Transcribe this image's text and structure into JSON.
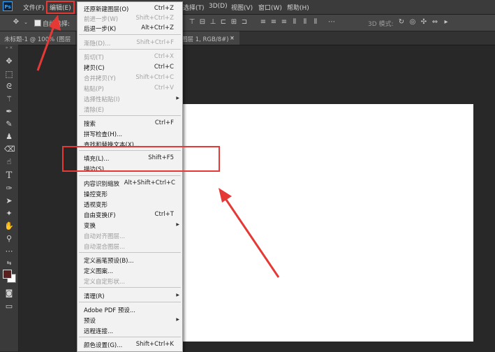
{
  "menubar": {
    "logo": "Ps",
    "items": [
      "文件(F)",
      "编辑(E)",
      "选择(T)",
      "3D(D)",
      "视图(V)",
      "窗口(W)",
      "帮助(H)"
    ]
  },
  "options_bar": {
    "auto_select_label": "自动选择:",
    "mode_label": "3D 模式:"
  },
  "tabs": [
    {
      "label": "未标题-1 @ 100% (图层"
    },
    {
      "label": "图层 1, RGB/8#) *"
    }
  ],
  "edit_menu": {
    "items": [
      {
        "label": "还原新建图层(O)",
        "shortcut": "Ctrl+Z",
        "enabled": true
      },
      {
        "label": "前进一步(W)",
        "shortcut": "Shift+Ctrl+Z",
        "enabled": false
      },
      {
        "label": "后退一步(K)",
        "shortcut": "Alt+Ctrl+Z",
        "enabled": true
      },
      {
        "label": "渐隐(D)...",
        "shortcut": "Shift+Ctrl+F",
        "enabled": false
      },
      {
        "label": "剪切(T)",
        "shortcut": "Ctrl+X",
        "enabled": false
      },
      {
        "label": "拷贝(C)",
        "shortcut": "Ctrl+C",
        "enabled": true
      },
      {
        "label": "合并拷贝(Y)",
        "shortcut": "Shift+Ctrl+C",
        "enabled": false
      },
      {
        "label": "粘贴(P)",
        "shortcut": "Ctrl+V",
        "enabled": false
      },
      {
        "label": "选择性粘贴(I)",
        "shortcut": "",
        "enabled": false,
        "submenu": true
      },
      {
        "label": "清除(E)",
        "shortcut": "",
        "enabled": false
      },
      {
        "label": "搜索",
        "shortcut": "Ctrl+F",
        "enabled": true
      },
      {
        "label": "拼写检查(H)...",
        "shortcut": "",
        "enabled": true
      },
      {
        "label": "查找和替换文本(X)...",
        "shortcut": "",
        "enabled": true
      },
      {
        "label": "填充(L)...",
        "shortcut": "Shift+F5",
        "enabled": true
      },
      {
        "label": "描边(S)...",
        "shortcut": "",
        "enabled": true
      },
      {
        "label": "内容识别缩放",
        "shortcut": "Alt+Shift+Ctrl+C",
        "enabled": true
      },
      {
        "label": "操控变形",
        "shortcut": "",
        "enabled": true
      },
      {
        "label": "透视变形",
        "shortcut": "",
        "enabled": true
      },
      {
        "label": "自由变换(F)",
        "shortcut": "Ctrl+T",
        "enabled": true
      },
      {
        "label": "变换",
        "shortcut": "",
        "enabled": true,
        "submenu": true
      },
      {
        "label": "自动对齐图层...",
        "shortcut": "",
        "enabled": false
      },
      {
        "label": "自动混合图层...",
        "shortcut": "",
        "enabled": false
      },
      {
        "label": "定义画笔预设(B)...",
        "shortcut": "",
        "enabled": true
      },
      {
        "label": "定义图案...",
        "shortcut": "",
        "enabled": true
      },
      {
        "label": "定义自定形状...",
        "shortcut": "",
        "enabled": false
      },
      {
        "label": "清理(R)",
        "shortcut": "",
        "enabled": true,
        "submenu": true
      },
      {
        "label": "Adobe PDF 预设...",
        "shortcut": "",
        "enabled": true
      },
      {
        "label": "预设",
        "shortcut": "",
        "enabled": true,
        "submenu": true
      },
      {
        "label": "远程连接...",
        "shortcut": "",
        "enabled": true
      },
      {
        "label": "颜色设置(G)...",
        "shortcut": "Shift+Ctrl+K",
        "enabled": true
      }
    ]
  },
  "colors": {
    "annotation": "#e53935",
    "foreground_swatch": "#5a1f1f",
    "background_swatch": "#ffffff"
  }
}
